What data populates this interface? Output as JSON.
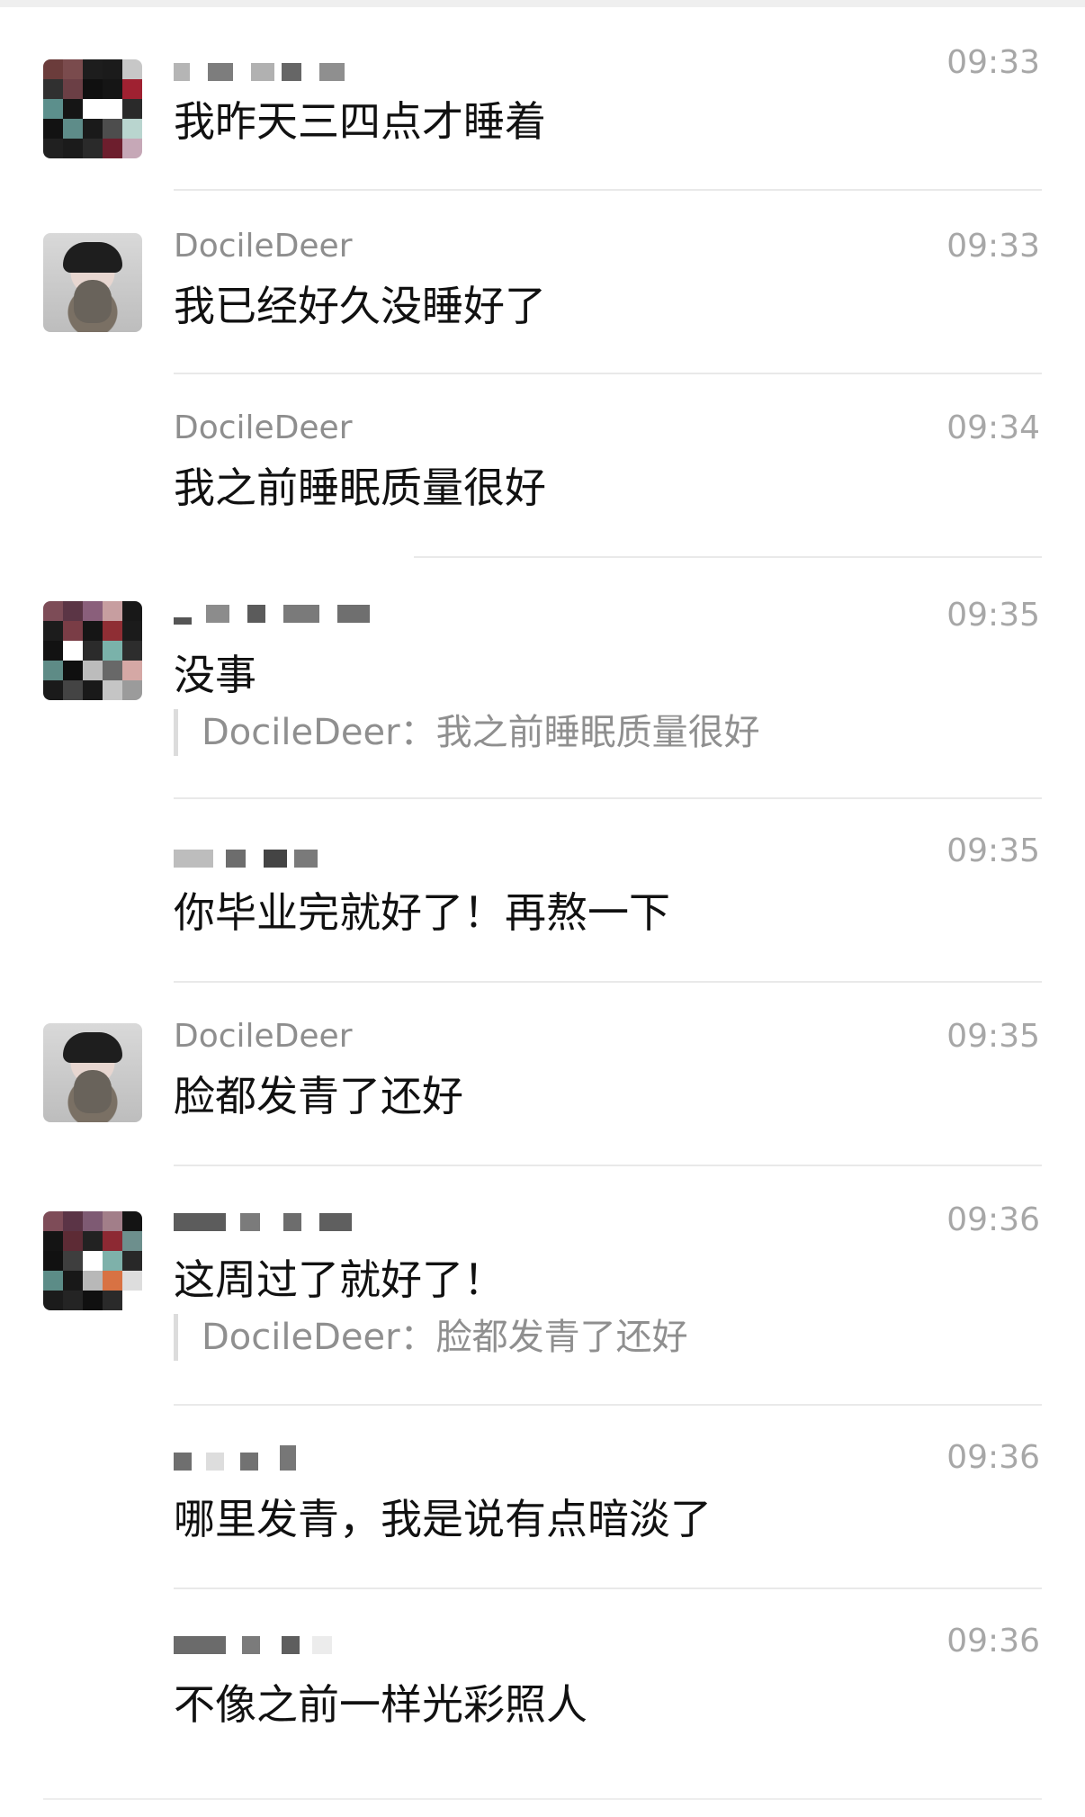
{
  "messages": [
    {
      "name": "",
      "time": "09:33",
      "text": "我昨天三四点才睡着",
      "quote": ""
    },
    {
      "name": "DocileDeer",
      "time": "09:33",
      "text": "我已经好久没睡好了",
      "quote": ""
    },
    {
      "name": "DocileDeer",
      "time": "09:34",
      "text": "我之前睡眠质量很好",
      "quote": ""
    },
    {
      "name": "",
      "time": "09:35",
      "text": "没事",
      "quote": "DocileDeer：我之前睡眠质量很好"
    },
    {
      "name": "",
      "time": "09:35",
      "text": "你毕业完就好了！再熬一下",
      "quote": ""
    },
    {
      "name": "DocileDeer",
      "time": "09:35",
      "text": "脸都发青了还好",
      "quote": ""
    },
    {
      "name": "",
      "time": "09:36",
      "text": "这周过了就好了！",
      "quote": "DocileDeer：脸都发青了还好"
    },
    {
      "name": "",
      "time": "09:36",
      "text": "哪里发青，我是说有点暗淡了",
      "quote": ""
    },
    {
      "name": "",
      "time": "09:36",
      "text": "不像之前一样光彩照人",
      "quote": ""
    }
  ]
}
